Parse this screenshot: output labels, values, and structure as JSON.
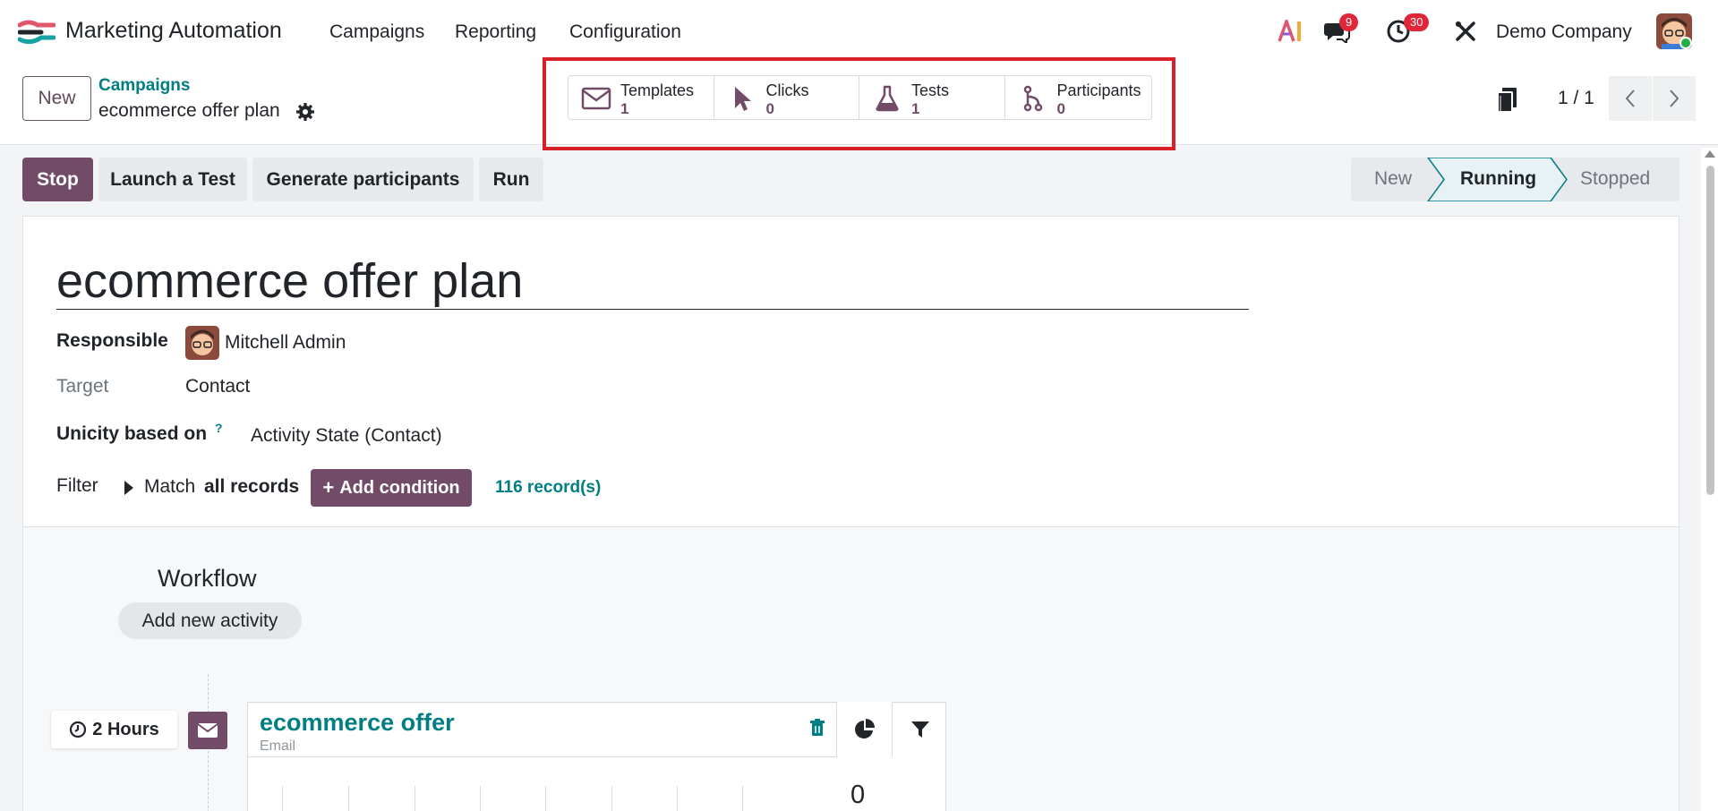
{
  "app": {
    "title": "Marketing Automation"
  },
  "menu": {
    "items": [
      "Campaigns",
      "Reporting",
      "Configuration"
    ]
  },
  "systray": {
    "messages_count": "9",
    "activities_count": "30",
    "company": "Demo Company"
  },
  "control": {
    "new_label": "New",
    "breadcrumb": "Campaigns",
    "record_name": "ecommerce offer plan",
    "pager": "1 / 1"
  },
  "stats": [
    {
      "label": "Templates",
      "value": "1",
      "icon": "envelope-icon"
    },
    {
      "label": "Clicks",
      "value": "0",
      "icon": "pointer-icon"
    },
    {
      "label": "Tests",
      "value": "1",
      "icon": "flask-icon"
    },
    {
      "label": "Participants",
      "value": "0",
      "icon": "branch-icon"
    }
  ],
  "actions": {
    "stop": "Stop",
    "test": "Launch a Test",
    "generate": "Generate participants",
    "run": "Run"
  },
  "stages": {
    "items": [
      "New",
      "Running",
      "Stopped"
    ],
    "current": "Running"
  },
  "form": {
    "title": "ecommerce offer plan",
    "responsible_label": "Responsible",
    "responsible_value": "Mitchell Admin",
    "target_label": "Target",
    "target_value": "Contact",
    "unicity_label": "Unicity based on",
    "unicity_help": "?",
    "unicity_value": "Activity State (Contact)",
    "filter_label": "Filter",
    "filter_match": "Match",
    "filter_scope": "all records",
    "add_condition": "Add condition",
    "records": "116 record(s)"
  },
  "workflow": {
    "title": "Workflow",
    "add_activity": "Add new activity",
    "activity": {
      "interval": "2 Hours",
      "name": "ecommerce offer",
      "type": "Email",
      "stat_value": "0"
    }
  },
  "colors": {
    "brand": "#714b67",
    "link": "#017e84",
    "highlight": "#d7202a"
  }
}
